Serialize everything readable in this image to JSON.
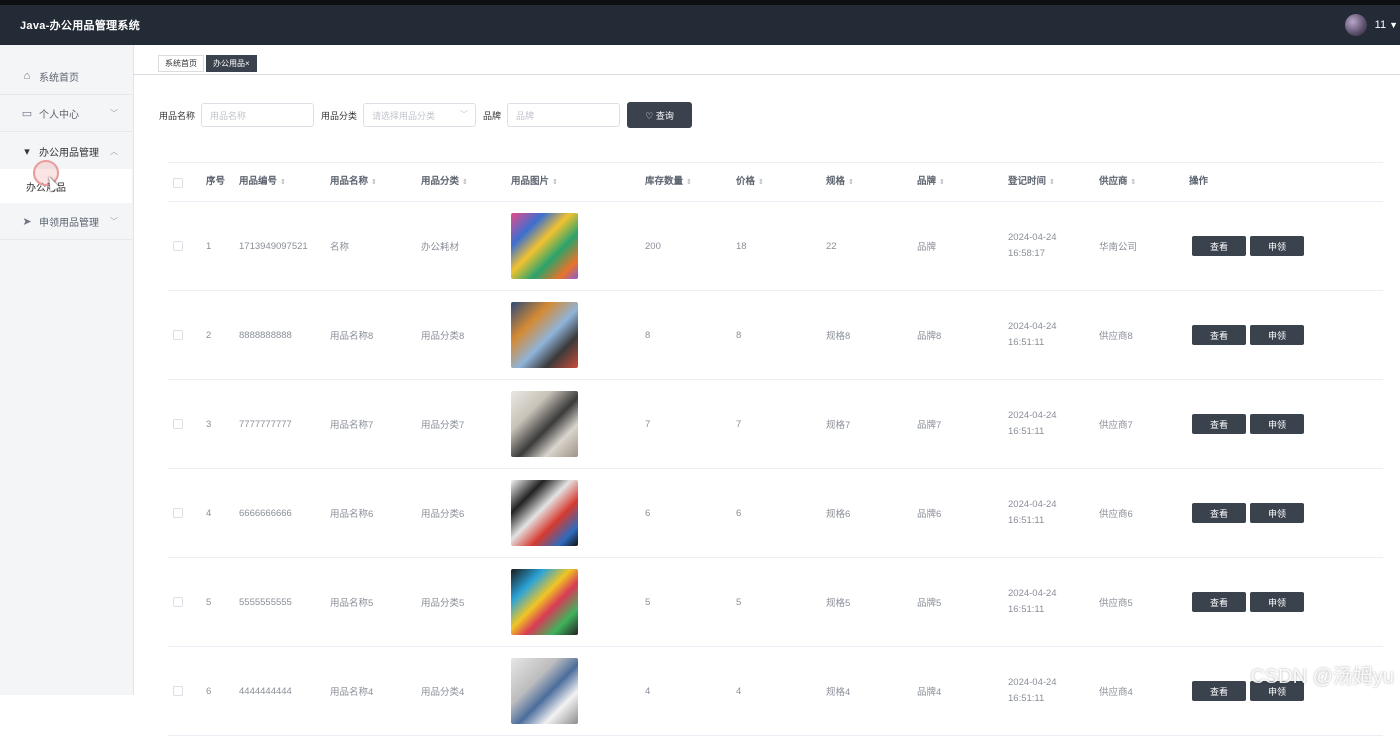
{
  "app": {
    "title": "Java-办公用品管理系统",
    "user": "11"
  },
  "sidebar": {
    "items": [
      {
        "label": "系统首页",
        "icon": "home-icon"
      },
      {
        "label": "个人中心",
        "icon": "calendar-icon"
      },
      {
        "label": "办公用品管理",
        "icon": "pin-icon"
      },
      {
        "label": "申领用品管理",
        "icon": "send-icon"
      }
    ],
    "submenu": {
      "label": "办公用品"
    }
  },
  "tabs": [
    {
      "label": "系统首页"
    },
    {
      "label": "办公用品×"
    }
  ],
  "search": {
    "name_label": "用品名称",
    "name_placeholder": "用品名称",
    "category_label": "用品分类",
    "category_placeholder": "请选择用品分类",
    "brand_label": "品牌",
    "brand_placeholder": "品牌",
    "query_button": "♡ 查询"
  },
  "table": {
    "headers": [
      "序号",
      "用品编号",
      "用品名称",
      "用品分类",
      "用品图片",
      "库存数量",
      "价格",
      "规格",
      "品牌",
      "登记时间",
      "供应商",
      "操作"
    ],
    "rows": [
      {
        "idx": "1",
        "code": "1713949097521",
        "name": "名称",
        "category": "办公耗材",
        "stock": "200",
        "price": "18",
        "spec": "22",
        "brand": "品牌",
        "time": "2024-04-24 16:58:17",
        "supplier": "华南公司"
      },
      {
        "idx": "2",
        "code": "8888888888",
        "name": "用品名称8",
        "category": "用品分类8",
        "stock": "8",
        "price": "8",
        "spec": "规格8",
        "brand": "品牌8",
        "time": "2024-04-24 16:51:11",
        "supplier": "供应商8"
      },
      {
        "idx": "3",
        "code": "7777777777",
        "name": "用品名称7",
        "category": "用品分类7",
        "stock": "7",
        "price": "7",
        "spec": "规格7",
        "brand": "品牌7",
        "time": "2024-04-24 16:51:11",
        "supplier": "供应商7"
      },
      {
        "idx": "4",
        "code": "6666666666",
        "name": "用品名称6",
        "category": "用品分类6",
        "stock": "6",
        "price": "6",
        "spec": "规格6",
        "brand": "品牌6",
        "time": "2024-04-24 16:51:11",
        "supplier": "供应商6"
      },
      {
        "idx": "5",
        "code": "5555555555",
        "name": "用品名称5",
        "category": "用品分类5",
        "stock": "5",
        "price": "5",
        "spec": "规格5",
        "brand": "品牌5",
        "time": "2024-04-24 16:51:11",
        "supplier": "供应商5"
      },
      {
        "idx": "6",
        "code": "4444444444",
        "name": "用品名称4",
        "category": "用品分类4",
        "stock": "4",
        "price": "4",
        "spec": "规格4",
        "brand": "品牌4",
        "time": "2024-04-24 16:51:11",
        "supplier": "供应商4"
      }
    ],
    "view_label": "查看",
    "apply_label": "申领"
  },
  "watermark": "CSDN @汤姆yu"
}
